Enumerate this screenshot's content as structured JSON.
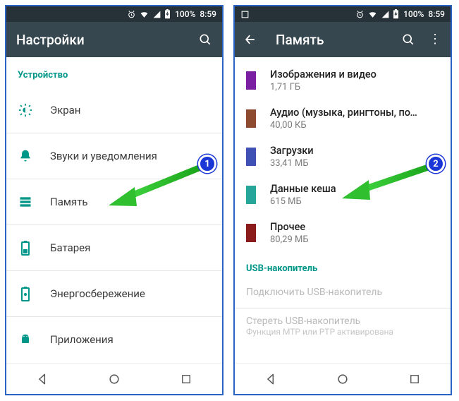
{
  "status": {
    "battery": "100%",
    "clock": "8:59"
  },
  "left": {
    "title": "Настройки",
    "section": "Устройство",
    "items": [
      {
        "label": "Экран"
      },
      {
        "label": "Звуки и уведомления"
      },
      {
        "label": "Память"
      },
      {
        "label": "Батарея"
      },
      {
        "label": "Энергосбережение"
      },
      {
        "label": "Приложения"
      }
    ]
  },
  "right": {
    "title": "Память",
    "items": [
      {
        "label": "Изображения и видео",
        "sub": "1,71 ГБ",
        "color": "#7b1fa2"
      },
      {
        "label": "Аудио (музыка, рингтоны, подкаст.",
        "sub": "40,00 КБ",
        "color": "#8d4a2f"
      },
      {
        "label": "Загрузки",
        "sub": "33,41 МБ",
        "color": "#3f51b5"
      },
      {
        "label": "Данные кеша",
        "sub": "615 МБ",
        "color": "#26a69a"
      },
      {
        "label": "Прочее",
        "sub": "80,29 МБ",
        "color": "#8b1a1a"
      }
    ],
    "usb_header": "USB-накопитель",
    "usb_connect": "Подключить USB-накопитель",
    "usb_erase": "Стереть USB-накопитель",
    "usb_sub": "Функция MTP или PTP активирована"
  },
  "badges": {
    "one": "1",
    "two": "2"
  }
}
